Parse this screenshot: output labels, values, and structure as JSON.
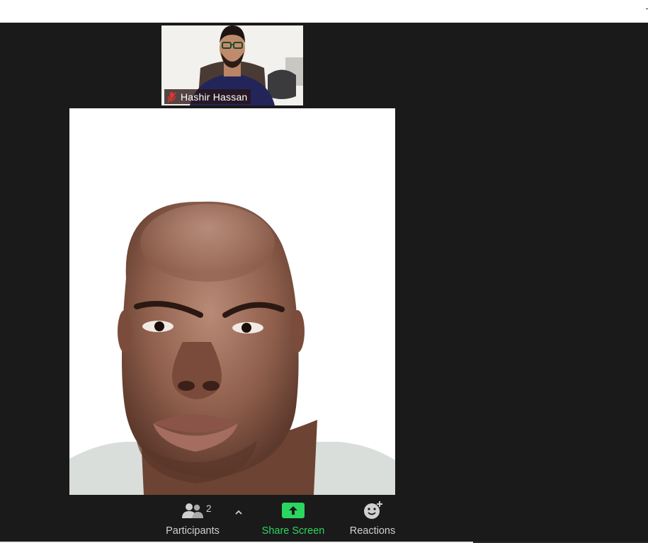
{
  "window": {
    "title": ""
  },
  "participants_thumb": {
    "name": "Hashir Hassan",
    "muted": true,
    "mic_icon": "mic-muted-icon"
  },
  "main_video": {
    "description_visible": false
  },
  "toolbar": {
    "participants": {
      "label": "Participants",
      "count": "2",
      "icon": "participants-icon"
    },
    "caret": {
      "icon": "chevron-up-icon"
    },
    "share_screen": {
      "label": "Share Screen",
      "icon": "share-screen-icon"
    },
    "reactions": {
      "label": "Reactions",
      "icon": "reaction-smiley-icon"
    }
  },
  "colors": {
    "background": "#1a1a1a",
    "share_green": "#2bd660",
    "toolbar_text": "#d0d0d0",
    "mute_red": "#e0332f"
  }
}
